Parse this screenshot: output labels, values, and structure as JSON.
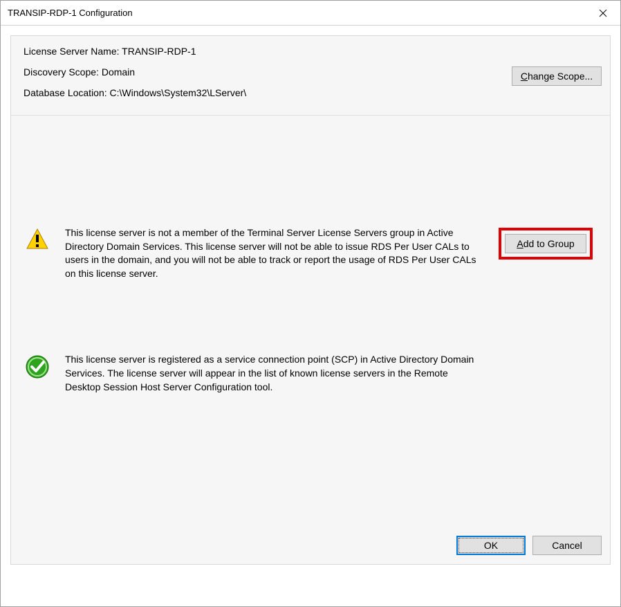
{
  "window": {
    "title": "TRANSIP-RDP-1 Configuration"
  },
  "info": {
    "serverNameLabel": "License Server Name:",
    "serverName": "TRANSIP-RDP-1",
    "scopeLabel": "Discovery Scope:",
    "scope": "Domain",
    "dbLabel": "Database Location:",
    "dbPath": "C:\\Windows\\System32\\LServer\\",
    "changeScopeBtn": "Change Scope..."
  },
  "status": {
    "warningText": "This license server is not a member of the Terminal Server License Servers group in Active Directory Domain Services. This license server will not be able to issue RDS Per User CALs to users in the domain, and you will not be able to track or report the usage of RDS Per User CALs on this license server.",
    "addToGroupBtn": "Add to Group",
    "okText": "This license server is registered as a service connection point (SCP) in Active Directory Domain Services. The license server will appear in the list of known license servers in the Remote Desktop Session Host Server Configuration tool."
  },
  "buttons": {
    "ok": "OK",
    "cancel": "Cancel"
  }
}
